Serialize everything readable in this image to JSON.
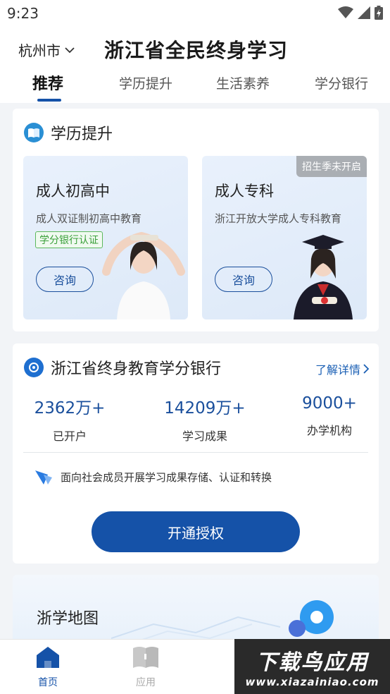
{
  "status_bar": {
    "time": "9:23"
  },
  "header": {
    "city": "杭州市",
    "title": "浙江省全民终身学习"
  },
  "tabs": [
    {
      "label": "推荐",
      "active": true
    },
    {
      "label": "学历提升"
    },
    {
      "label": "生活素养"
    },
    {
      "label": "学分银行"
    }
  ],
  "education": {
    "title": "学历提升",
    "cards": [
      {
        "name": "成人初高中",
        "desc": "成人双证制初高中教育",
        "badge": "学分银行认证",
        "button": "咨询"
      },
      {
        "name": "成人专科",
        "desc": "浙江开放大学成人专科教育",
        "tag": "招生季未开启",
        "button": "咨询"
      }
    ]
  },
  "credit_bank": {
    "title": "浙江省终身教育学分银行",
    "more": "了解详情",
    "stats": [
      {
        "value": "2362万+",
        "label": "已开户"
      },
      {
        "value": "14209万+",
        "label": "学习成果"
      },
      {
        "value": "9000+",
        "label": "办学机构"
      }
    ],
    "note": "面向社会成员开展学习成果存储、认证和转换",
    "button": "开通授权"
  },
  "map": {
    "title": "浙学地图"
  },
  "bottom_nav": [
    {
      "label": "首页",
      "active": true
    },
    {
      "label": "应用"
    }
  ],
  "watermark": {
    "main": "下载鸟应用",
    "url": "www.xiazainiao.com"
  },
  "colors": {
    "primary": "#1552a8",
    "green_badge": "#3aa03a",
    "background": "#f2f4f7"
  }
}
